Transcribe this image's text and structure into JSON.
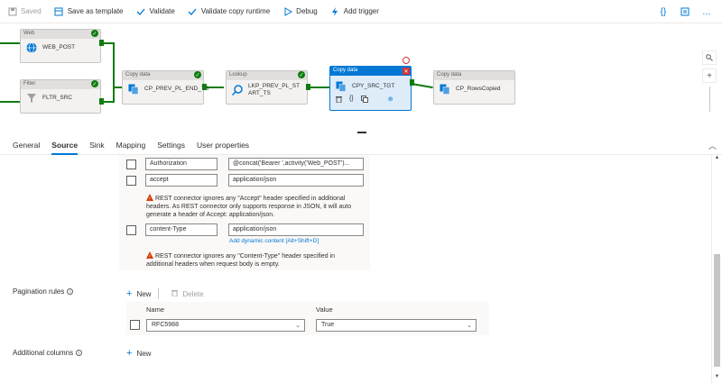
{
  "toolbar": {
    "saved": "Saved",
    "save_as_template": "Save as template",
    "validate": "Validate",
    "validate_copy_runtime": "Validate copy runtime",
    "debug": "Debug",
    "add_trigger": "Add trigger"
  },
  "canvas": {
    "nodes": [
      {
        "type": "Web",
        "name": "WEB_POST"
      },
      {
        "type": "Filter",
        "name": "FLTR_SRC"
      },
      {
        "type": "Copy data",
        "name": "CP_PREV_PL_END_TS"
      },
      {
        "type": "Lookup",
        "name": "LKP_PREV_PL_START_TS"
      },
      {
        "type": "Copy data",
        "name": "CPY_SRC_TGT"
      },
      {
        "type": "Copy data",
        "name": "CP_RowsCopied"
      }
    ]
  },
  "tabs": [
    "General",
    "Source",
    "Sink",
    "Mapping",
    "Settings",
    "User properties"
  ],
  "active_tab": "Source",
  "headers": [
    {
      "name": "Authorization",
      "value": "@concat('Bearer ',activity('Web_POST')..."
    },
    {
      "name": "accept",
      "value": "application/json"
    },
    {
      "name": "content-Type",
      "value": "application/json"
    }
  ],
  "warn_accept": "REST connector ignores any \"Accept\" header specified in additional headers. As REST connector only supports response in JSON, it will auto generate a header of Accept: application/json.",
  "add_dynamic_content": "Add dynamic content [Alt+Shift+D]",
  "warn_content_type": "REST connector ignores any \"Content-Type\" header specified in additional headers when request body is empty.",
  "pagination": {
    "label": "Pagination rules",
    "new": "New",
    "delete": "Delete",
    "col_name": "Name",
    "col_value": "Value",
    "row_name": "RFC5988",
    "row_value": "True"
  },
  "additional_columns": {
    "label": "Additional columns",
    "new": "New"
  },
  "colors": {
    "accent": "#0078d4",
    "success": "#107c10",
    "warning": "#d83b01",
    "error": "#d13438"
  }
}
